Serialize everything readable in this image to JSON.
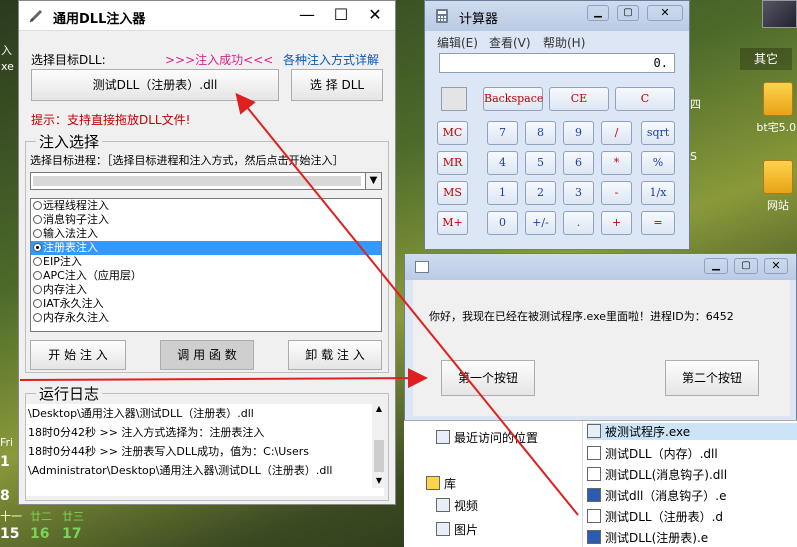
{
  "desktop": {
    "left_labels": [
      "入",
      "xe"
    ],
    "cal_rows": [
      {
        "a": "Fri",
        "b": ""
      },
      {
        "a": "1",
        "b": ""
      },
      {
        "a": "8",
        "b": ""
      },
      {
        "a": "十一",
        "b": ""
      },
      {
        "a": "15",
        "b": "16",
        "c": "17"
      },
      {
        "a": "",
        "b": "廿二",
        "c": "廿三"
      }
    ],
    "right_icons": [
      {
        "label": "其它"
      },
      {
        "label": "bt宅5.0."
      },
      {
        "label": "网站"
      }
    ],
    "right_partial": [
      "四",
      "S"
    ],
    "other_label": "其它"
  },
  "injector": {
    "title": "通用DLL注入器",
    "select_dll_label": "选择目标DLL:",
    "status": ">>>注入成功<<<",
    "methods_link": "各种注入方式详解",
    "dll_path": "测试DLL（注册表）.dll",
    "select_dll_btn": "选 择 DLL",
    "tip": "提示：支持直接拖放DLL文件!",
    "group_title": "注入选择",
    "process_label": "选择目标进程：［选择目标进程和注入方式，然后点击开始注入］",
    "methods": [
      {
        "label": "远程线程注入",
        "selected": false
      },
      {
        "label": "消息钩子注入",
        "selected": false
      },
      {
        "label": "输入法注入",
        "selected": false
      },
      {
        "label": "注册表注入",
        "selected": true
      },
      {
        "label": "EIP注入",
        "selected": false
      },
      {
        "label": "APC注入（应用层）",
        "selected": false
      },
      {
        "label": "内存注入",
        "selected": false
      },
      {
        "label": "IAT永久注入",
        "selected": false
      },
      {
        "label": "内存永久注入",
        "selected": false
      }
    ],
    "start_btn": "开 始 注 入",
    "call_btn": "调 用 函 数",
    "unload_btn": "卸 载 注 入",
    "log_title": "运行日志",
    "log_lines": [
      "\\Desktop\\通用注入器\\测试DLL（注册表）.dll",
      "18时0分42秒 >> 注入方式选择为：注册表注入",
      "18时0分44秒 >> 注册表写入DLL成功，值为：C:\\Users",
      "\\Administrator\\Desktop\\通用注入器\\测试DLL（注册表）.dll"
    ]
  },
  "calculator": {
    "title": "计算器",
    "menu": [
      "编辑(E)",
      "查看(V)",
      "帮助(H)"
    ],
    "display": "0.",
    "row0": [
      "Backspace",
      "CE",
      "C"
    ],
    "rows": [
      [
        "MC",
        "7",
        "8",
        "9",
        "/",
        "sqrt"
      ],
      [
        "MR",
        "4",
        "5",
        "6",
        "*",
        "%"
      ],
      [
        "MS",
        "1",
        "2",
        "3",
        "-",
        "1/x"
      ],
      [
        "M+",
        "0",
        "+/-",
        ".",
        "+",
        "="
      ]
    ]
  },
  "dialog": {
    "message": "你好，我现在已经在被测试程序.exe里面啦！进程ID为：6452",
    "btn1": "第一个按钮",
    "btn2": "第二个按钮"
  },
  "explorer": {
    "left_items": [
      "最近访问的位置",
      "库",
      "视频",
      "图片"
    ],
    "files": [
      "被测试程序.exe",
      "测试DLL（内存）.dll",
      "测试DLL(消息钩子).dll",
      "测试dll（消息钩子）.e",
      "测试DLL（注册表）.d",
      "测试DLL(注册表).e"
    ]
  },
  "colors": {
    "status": "#e0218a",
    "link": "#0a58b6",
    "tip": "#c00000",
    "arrow": "#e02020"
  }
}
